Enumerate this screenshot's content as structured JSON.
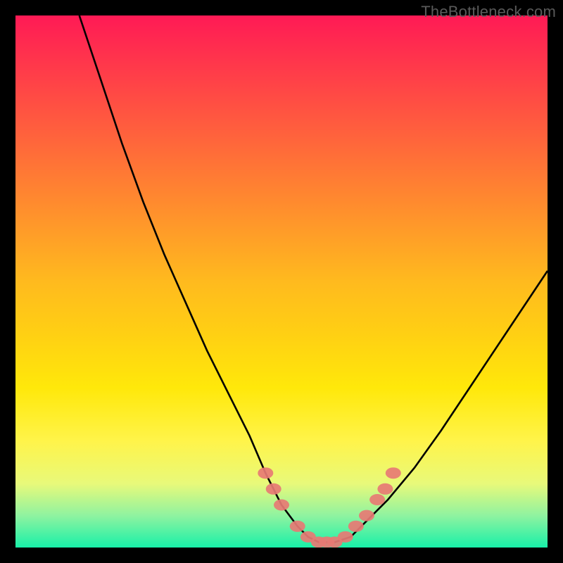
{
  "watermark": "TheBottleneck.com",
  "chart_data": {
    "type": "line",
    "title": "",
    "xlabel": "",
    "ylabel": "",
    "xlim": [
      0,
      100
    ],
    "ylim": [
      0,
      100
    ],
    "series": [
      {
        "name": "bottleneck-curve",
        "x": [
          12,
          16,
          20,
          24,
          28,
          32,
          36,
          40,
          44,
          47,
          50,
          53,
          55,
          57,
          60,
          63,
          66,
          70,
          75,
          80,
          86,
          92,
          100
        ],
        "y": [
          100,
          88,
          76,
          65,
          55,
          46,
          37,
          29,
          21,
          14,
          8,
          4,
          2,
          1,
          1,
          2,
          5,
          9,
          15,
          22,
          31,
          40,
          52
        ]
      }
    ],
    "markers": {
      "name": "highlighted-range",
      "color": "#e77a74",
      "points": [
        {
          "x": 47,
          "y": 14
        },
        {
          "x": 48.5,
          "y": 11
        },
        {
          "x": 50,
          "y": 8
        },
        {
          "x": 53,
          "y": 4
        },
        {
          "x": 55,
          "y": 2
        },
        {
          "x": 57,
          "y": 1
        },
        {
          "x": 58.5,
          "y": 1
        },
        {
          "x": 60,
          "y": 1
        },
        {
          "x": 62,
          "y": 2
        },
        {
          "x": 64,
          "y": 4
        },
        {
          "x": 66,
          "y": 6
        },
        {
          "x": 68,
          "y": 9
        },
        {
          "x": 69.5,
          "y": 11
        },
        {
          "x": 71,
          "y": 14
        }
      ]
    },
    "gradient_stops": [
      {
        "pos": 0,
        "color": "#ff1a55"
      },
      {
        "pos": 50,
        "color": "#ffba1e"
      },
      {
        "pos": 80,
        "color": "#fff44a"
      },
      {
        "pos": 100,
        "color": "#18f0a8"
      }
    ]
  }
}
